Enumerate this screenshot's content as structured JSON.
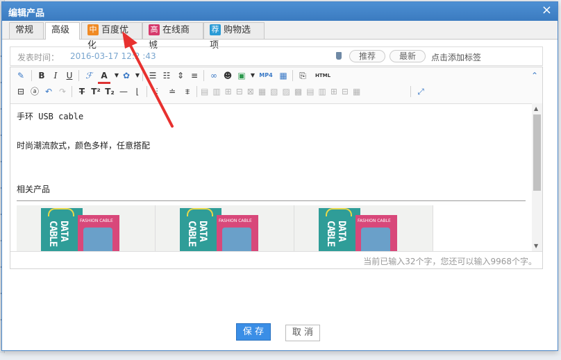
{
  "dialog": {
    "title": "编辑产品",
    "close_glyph": "×"
  },
  "tabs": [
    {
      "label": "常规",
      "badge": ""
    },
    {
      "label": "高级",
      "badge": ""
    },
    {
      "label": "百度优化",
      "badge": "中",
      "badge_color": "#f08a24"
    },
    {
      "label": "在线商城",
      "badge": "高",
      "badge_color": "#d63a6c"
    },
    {
      "label": "购物选项",
      "badge": "荐",
      "badge_color": "#2a9bd6"
    }
  ],
  "active_tab": "高级",
  "meta": {
    "publish_label": "发表时间：",
    "publish_date": "2016-03-17 12:2 :43",
    "recommend_label": "推荐",
    "newest_label": "最新",
    "add_tag_label": "点击添加标签"
  },
  "toolbar": {
    "row1": [
      "eraser-icon",
      "bold-icon",
      "italic-icon",
      "underline-icon",
      "font-family-icon",
      "font-color-icon",
      "highlight-icon",
      "ordered-list-icon",
      "unordered-list-icon",
      "line-height-icon",
      "justify-icon",
      "link-icon",
      "qq-icon",
      "image-icon",
      "video-icon",
      "table-icon",
      "source-icon",
      "html-icon"
    ],
    "row1_glyphs": {
      "bold": "B",
      "italic": "I",
      "underline": "U",
      "video": "MP4",
      "html": "HTML"
    },
    "row2": [
      "save-icon",
      "preview-icon",
      "undo-icon",
      "redo-icon",
      "strikethrough-icon",
      "superscript-icon",
      "subscript-icon",
      "hr-icon",
      "indent-icon",
      "align-left-icon",
      "align-center-icon",
      "align-right-icon",
      "table-ops-icon",
      "fullscreen-icon"
    ],
    "row2_glyphs": {
      "strike": "T",
      "sup": "T²",
      "sub": "T₂"
    }
  },
  "editor": {
    "lines": [
      "手环 USB cable",
      "时尚潮流款式，颜色多样，任意搭配",
      "相关产品"
    ],
    "product_label": "FASHION CABLE",
    "box_label": "DATA CABLE",
    "status": "当前已输入32个字，您还可以输入9968个字。"
  },
  "buttons": {
    "save": "保 存",
    "cancel": "取 消"
  },
  "colors": {
    "title_bar": "#3b7bc0",
    "save_button": "#3a8ee6",
    "annotation_arrow": "#e8312f"
  }
}
